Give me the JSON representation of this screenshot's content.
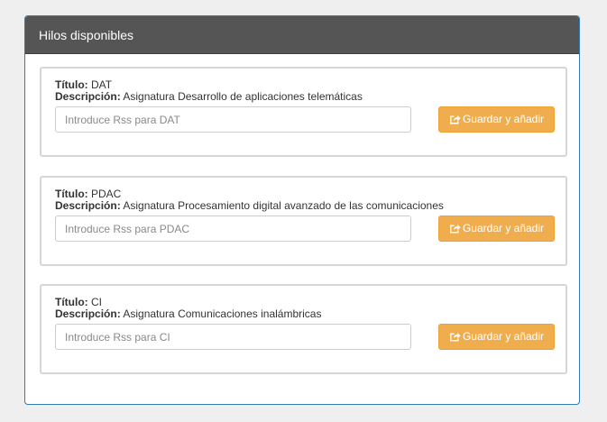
{
  "panel": {
    "title": "Hilos disponibles"
  },
  "labels": {
    "title": "Título:",
    "description": "Descripción:"
  },
  "cards": [
    {
      "title": "DAT",
      "description": "Asignatura Desarrollo de aplicaciones telemáticas",
      "placeholder": "Introduce Rss para DAT",
      "button_label": "Guardar y añadir",
      "button_icon": "share-icon"
    },
    {
      "title": "PDAC",
      "description": "Asignatura Procesamiento digital avanzado de las comunicaciones",
      "placeholder": "Introduce Rss para PDAC",
      "button_label": "Guardar y añadir",
      "button_icon": "share-icon"
    },
    {
      "title": "CI",
      "description": "Asignatura Comunicaciones inalámbricas",
      "placeholder": "Introduce Rss para CI",
      "button_label": "Guardar y añadir",
      "button_icon": "share-icon"
    }
  ],
  "colors": {
    "panel_heading": "#555555",
    "panel_border": "#337ab7",
    "button_warning": "#f0ad4e",
    "page_background": "#efefef"
  }
}
